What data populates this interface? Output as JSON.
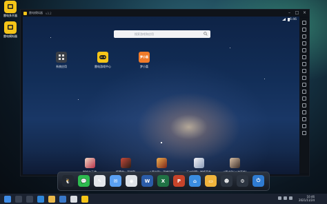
{
  "desktop": {
    "icons": [
      {
        "label": "雷电多开器"
      },
      {
        "label": "雷电模拟器"
      }
    ]
  },
  "window": {
    "title": "雷电模拟器",
    "version": "v3.2",
    "controls": [
      "minimize",
      "restore",
      "close"
    ]
  },
  "android": {
    "status": {
      "time": "6:46"
    },
    "search": {
      "placeholder": "搜索游戏和应用"
    },
    "apps": [
      {
        "label": "系统应用",
        "color": "#3a3f47"
      },
      {
        "label": "雷电游戏中心",
        "color": "#f5c518"
      },
      {
        "label": "梦小喜",
        "color": "#f07b2a",
        "badge": "梦小喜"
      }
    ],
    "games": [
      {
        "label": "御城大天使",
        "color": "#b6334a"
      },
      {
        "label": "镇魔曲：武神殿",
        "color": "#5a3b2c"
      },
      {
        "label": "斗罗大陆：武魂觉醒",
        "color": "#c75a2d"
      },
      {
        "label": "天刀觉醒：巅峰再临",
        "color": "#8a9bb8"
      },
      {
        "label": "斗罗大陆(斗神再临)",
        "color": "#5d4a3f"
      }
    ]
  },
  "dock": {
    "items": [
      {
        "name": "qq",
        "color": "#222831",
        "glyph": "🐧"
      },
      {
        "name": "wechat",
        "color": "#2dbb4f",
        "glyph": "💬"
      },
      {
        "name": "paint",
        "color": "#e4e6ea",
        "glyph": "✎"
      },
      {
        "name": "mail",
        "color": "#5aa0f2",
        "glyph": "✉"
      },
      {
        "name": "chrome",
        "color": "#dfe3e8",
        "glyph": "◉"
      },
      {
        "name": "word",
        "color": "#2b5ca8",
        "glyph": "W"
      },
      {
        "name": "excel",
        "color": "#207245",
        "glyph": "X"
      },
      {
        "name": "powerpoint",
        "color": "#c8442a",
        "glyph": "P"
      },
      {
        "name": "home",
        "color": "#3a8de0",
        "glyph": "⌂"
      },
      {
        "name": "folder",
        "color": "#f0b43c",
        "glyph": "▭"
      },
      {
        "name": "gamepad",
        "color": "#2c3440",
        "glyph": "☻"
      },
      {
        "name": "settings",
        "color": "#2c3440",
        "glyph": "⚙"
      },
      {
        "name": "power",
        "color": "#2f7bd1",
        "glyph": "⏻"
      }
    ]
  },
  "taskbar": {
    "items": [
      {
        "name": "start",
        "color": "#3f8ce6"
      },
      {
        "name": "search",
        "color": "#3a4353"
      },
      {
        "name": "task-view",
        "color": "#3a4353"
      },
      {
        "name": "edge",
        "color": "#2f86d8"
      },
      {
        "name": "explorer",
        "color": "#e9b84a"
      },
      {
        "name": "store",
        "color": "#3a78c8"
      },
      {
        "name": "chrome",
        "color": "#d9dde2"
      },
      {
        "name": "ldplayer",
        "color": "#f5c518"
      }
    ],
    "clock": {
      "time": "10:46",
      "date": "2021/11/24"
    }
  }
}
